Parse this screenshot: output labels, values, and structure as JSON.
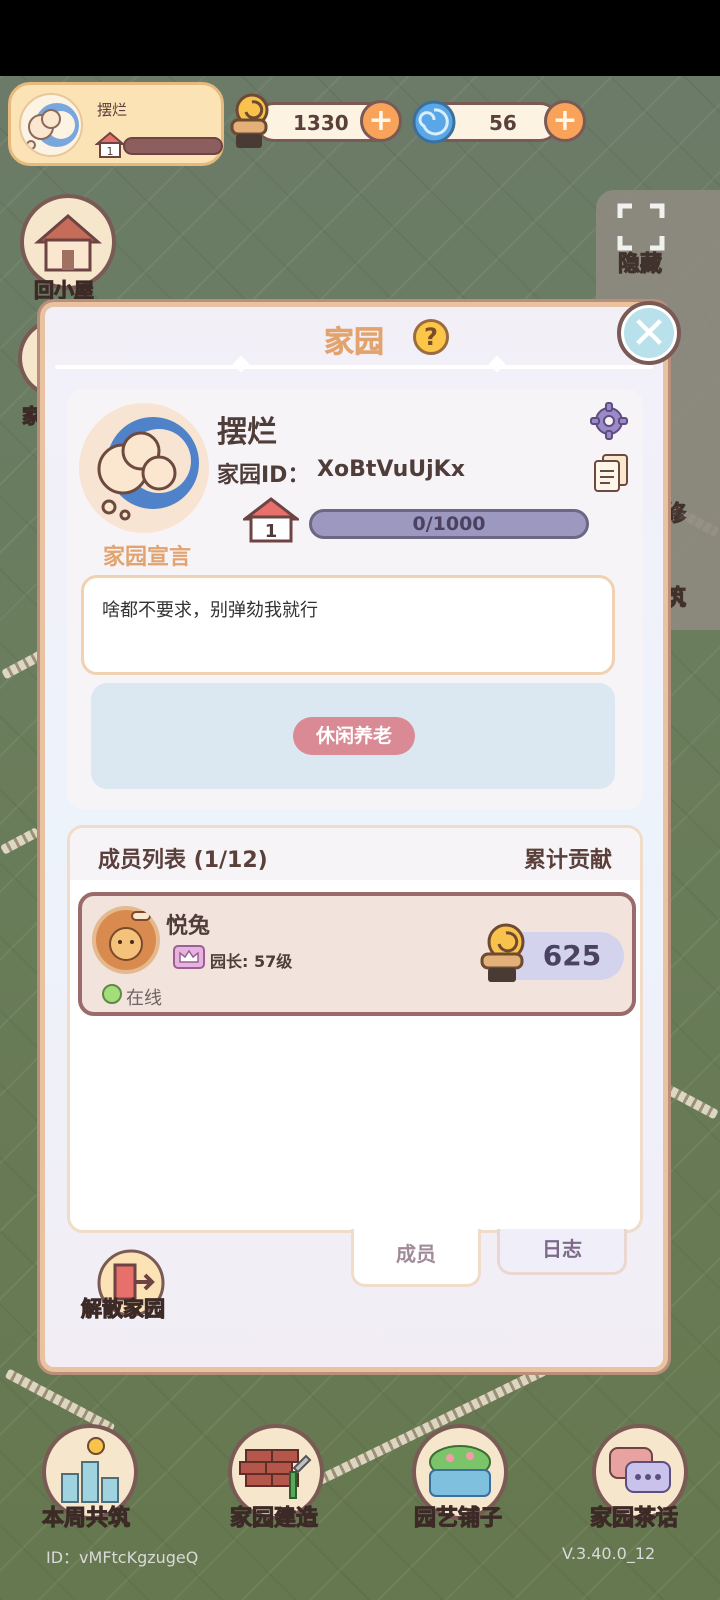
{
  "hud": {
    "home_name": "摆烂",
    "home_level": "1",
    "snail_count": "1330",
    "swirl_count": "56"
  },
  "background": {
    "left_button_label": "回小屋",
    "left_button_label_2": "家",
    "right_hide_label": "隐藏",
    "right_label_repair": "修",
    "right_label_build": "筑"
  },
  "modal": {
    "title": "家园",
    "help_glyph": "?",
    "close_glyph": "✕",
    "home_name": "摆烂",
    "home_id_label": "家园ID：",
    "home_id_value": "XoBtVuUjKx",
    "level": "1",
    "exp_text": "0/1000",
    "declaration_title": "家园宣言",
    "declaration_text": "啥都不要求，别弹劾我就行",
    "tag": "休闲养老",
    "member_list_title": "成员列表 (1/12)",
    "contribution_title": "累计贡献",
    "members": [
      {
        "name": "悦兔",
        "role": "园长: 57级",
        "status": "在线",
        "contribution": "625"
      }
    ],
    "tabs": {
      "members": "成员",
      "log": "日志"
    },
    "disband_label": "解散家园"
  },
  "bottom_bar": {
    "weekly_build": "本周共筑",
    "home_build": "家园建造",
    "garden_shop": "园艺铺子",
    "home_chat": "家园茶话"
  },
  "footer": {
    "id_text": "ID：vMFtcKgzugeQ",
    "version": "V.3.40.0_12"
  },
  "colors": {
    "accent_orange": "#e2a36e",
    "border_brown": "#7a5a55",
    "tag_pink": "#d98a95",
    "online_green": "#a4dd79"
  }
}
